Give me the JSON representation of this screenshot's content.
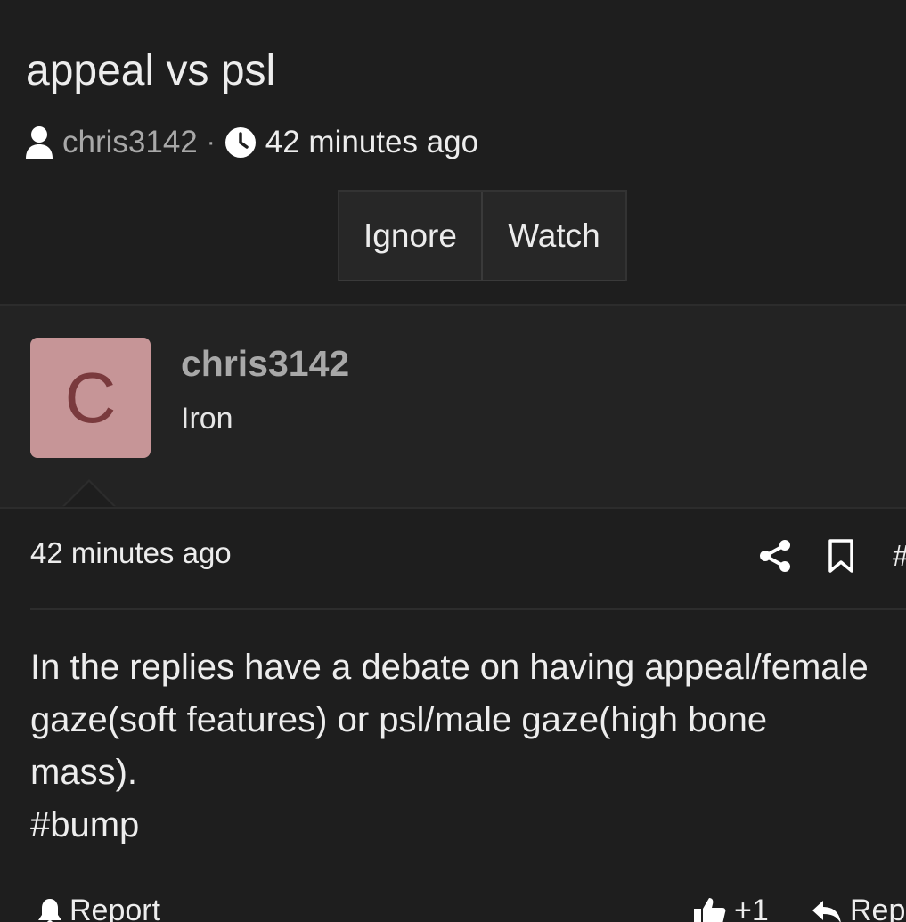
{
  "thread": {
    "title": "appeal vs psl",
    "author": "chris3142",
    "separator": "·",
    "time": "42 minutes ago",
    "buttons": {
      "ignore": "Ignore",
      "watch": "Watch"
    }
  },
  "post": {
    "avatar_letter": "C",
    "author": "chris3142",
    "rank": "Iron",
    "time": "42 minutes ago",
    "hash_link": "#",
    "body_lines": [
      "In the replies have a debate on having appeal/female",
      "gaze(soft features) or psl/male gaze(high bone",
      "mass).",
      "#bump"
    ],
    "footer": {
      "report": "Report",
      "upvote": "+1",
      "reply": "Reply"
    }
  },
  "icons": {
    "author": "user-icon",
    "time": "clock-icon",
    "share": "share-icon",
    "bookmark": "bookmark-icon",
    "report": "bell-icon",
    "upvote": "thumbs-up-icon",
    "reply": "reply-icon"
  },
  "colors": {
    "background": "#1e1e1e",
    "author_band": "#232323",
    "avatar_bg": "#c69597",
    "avatar_letter": "#7a3a3d",
    "muted_text": "#a8a8a8",
    "text": "#ededed"
  }
}
